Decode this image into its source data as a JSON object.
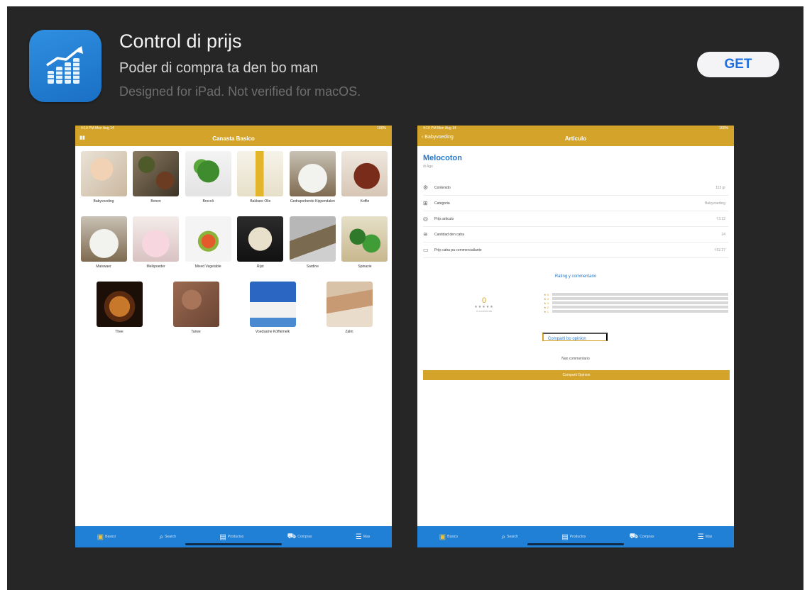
{
  "app": {
    "title": "Control di prijs",
    "subtitle": "Poder di compra ta den bo man",
    "note": "Designed for iPad. Not verified for macOS.",
    "get_label": "GET",
    "icon": "rising-chart-coins-icon",
    "accent": "#1f6fe0"
  },
  "colors": {
    "gold": "#d4a42a",
    "tabbar": "#1f80d6",
    "link": "#2777c8"
  },
  "screen1": {
    "status_left": "4:10 PM  Mon Aug 14",
    "status_right": "100%",
    "nav_title": "Canasta Basico",
    "rows": [
      [
        {
          "label": "Babyvoeding",
          "img": "baby"
        },
        {
          "label": "Bonen",
          "img": "beans"
        },
        {
          "label": "Brocoli",
          "img": "broccoli"
        },
        {
          "label": "Bakbare Olie",
          "img": "oil"
        },
        {
          "label": "Gedraporberde Kippendalen",
          "img": "rice"
        },
        {
          "label": "Koffie",
          "img": "coffee"
        }
      ],
      [
        {
          "label": "Maiswaer",
          "img": "rice"
        },
        {
          "label": "Melkpoeder",
          "img": "powder"
        },
        {
          "label": "Mixed Vegetable",
          "img": "veg"
        },
        {
          "label": "Rijst",
          "img": "noodles"
        },
        {
          "label": "Sardine",
          "img": "sardine"
        },
        {
          "label": "Spinazie",
          "img": "spinach"
        }
      ],
      [
        {
          "label": "Thee",
          "img": "tea"
        },
        {
          "label": "Tarwe",
          "img": "bread"
        },
        {
          "label": "Voedsame Koffiemelk",
          "img": "milk"
        },
        {
          "label": "Zalm",
          "img": "crackers"
        }
      ]
    ]
  },
  "screen2": {
    "status_left": "4:10 PM  Mon Aug 14",
    "status_right": "100%",
    "back_label": "Babyvoeding",
    "nav_title": "Articulo",
    "title": "Melocoton",
    "subtitle": "di Ago",
    "info": [
      {
        "icon": "box-icon",
        "label": "Contenido",
        "value": "113 gr"
      },
      {
        "icon": "tag-icon",
        "label": "Categoria",
        "value": "Babyvoeding"
      },
      {
        "icon": "price-icon",
        "label": "Prijs articulo",
        "value": "f 3.12"
      },
      {
        "icon": "quantity-icon",
        "label": "Cantidad den caha",
        "value": "24"
      },
      {
        "icon": "calendar-icon",
        "label": "Prijs caha pa commercialiante",
        "value": "f 52.27"
      }
    ],
    "rating_title": "Rating y commentario",
    "score": "0",
    "stars": "★★★★★",
    "comment_count": "0 comments",
    "bar_labels": [
      "★ 5",
      "★ 4",
      "★ 3",
      "★ 2",
      "★ 1"
    ],
    "share_label": "Comparti bo opinion",
    "comment_placeholder": "Nan commentario",
    "submit_label": "Comparti Opinion"
  },
  "tabs": [
    {
      "label": "Basico",
      "icon": "basket-icon"
    },
    {
      "label": "Search",
      "icon": "search-icon"
    },
    {
      "label": "Productos",
      "icon": "document-icon"
    },
    {
      "label": "Compras",
      "icon": "cart-icon"
    },
    {
      "label": "Mas",
      "icon": "menu-icon"
    }
  ]
}
